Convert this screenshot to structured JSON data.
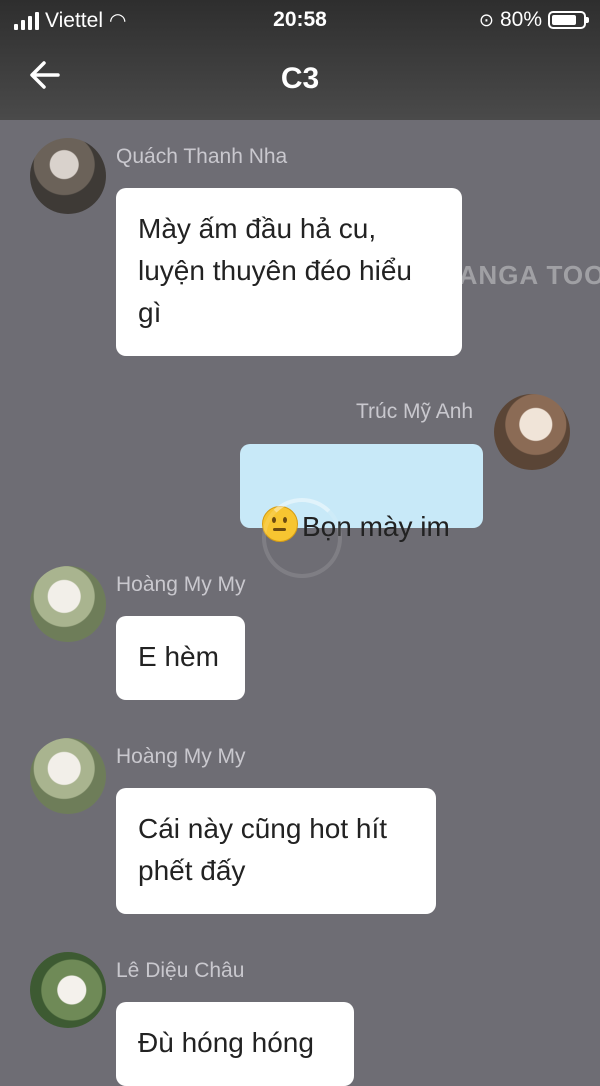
{
  "status_bar": {
    "carrier": "Viettel",
    "time": "20:58",
    "battery_percent": "80%",
    "battery_level": 0.8
  },
  "header": {
    "back_icon": "arrow-left-icon",
    "title": "C3"
  },
  "watermark": "MANGA TOON",
  "messages": [
    {
      "sender": "Quách Thanh Nha",
      "text": "Mày ấm đầu hả cu,\nluyện thuyên đéo hiểu\ngì",
      "side": "left"
    },
    {
      "sender": "Trúc Mỹ Anh",
      "emoji": "slightly-smiling-face-icon",
      "text": "Bọn mày im",
      "side": "right"
    },
    {
      "sender": "Hoàng My My",
      "text": "E hèm",
      "side": "left"
    },
    {
      "sender": "Hoàng My My",
      "text": "Cái này cũng hot hít\nphết đấy",
      "side": "left"
    },
    {
      "sender": "Lê Diệu Châu",
      "text": "Đù hóng hóng",
      "side": "left"
    }
  ]
}
